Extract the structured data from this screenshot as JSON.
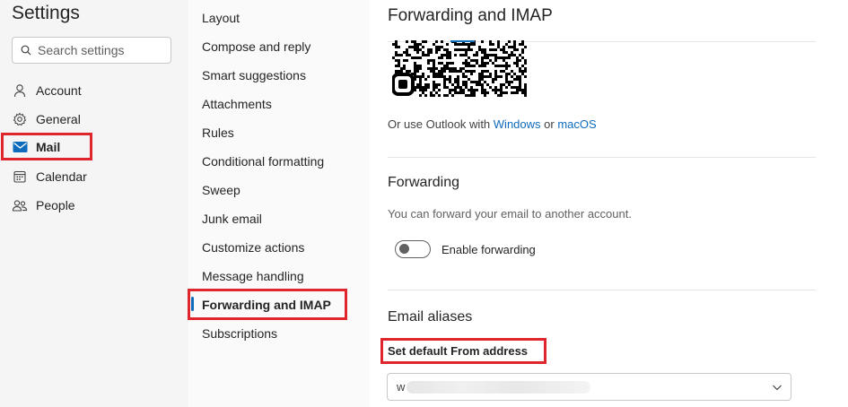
{
  "settings": {
    "title": "Settings",
    "search_placeholder": "Search settings",
    "nav": [
      {
        "label": "Account",
        "icon": "person-icon"
      },
      {
        "label": "General",
        "icon": "gear-icon"
      },
      {
        "label": "Mail",
        "icon": "mail-icon",
        "selected": true
      },
      {
        "label": "Calendar",
        "icon": "calendar-icon"
      },
      {
        "label": "People",
        "icon": "people-icon"
      }
    ]
  },
  "mail_menu": {
    "items": [
      {
        "label": "Layout"
      },
      {
        "label": "Compose and reply"
      },
      {
        "label": "Smart suggestions"
      },
      {
        "label": "Attachments"
      },
      {
        "label": "Rules"
      },
      {
        "label": "Conditional formatting"
      },
      {
        "label": "Sweep"
      },
      {
        "label": "Junk email"
      },
      {
        "label": "Customize actions"
      },
      {
        "label": "Message handling"
      },
      {
        "label": "Forwarding and IMAP",
        "selected": true
      },
      {
        "label": "Subscriptions"
      }
    ]
  },
  "pane": {
    "title": "Forwarding and IMAP",
    "outlook_prefix": "Or use Outlook with",
    "outlook_windows": "Windows",
    "outlook_or": "or",
    "outlook_macos": "macOS",
    "forwarding": {
      "heading": "Forwarding",
      "description": "You can forward your email to another account.",
      "toggle_label": "Enable forwarding",
      "enabled": false
    },
    "aliases": {
      "heading": "Email aliases",
      "default_from_label": "Set default From address",
      "selected_value_prefix": "w"
    }
  },
  "colors": {
    "accent": "#0f6cbd",
    "highlight_box": "#e0262d"
  }
}
